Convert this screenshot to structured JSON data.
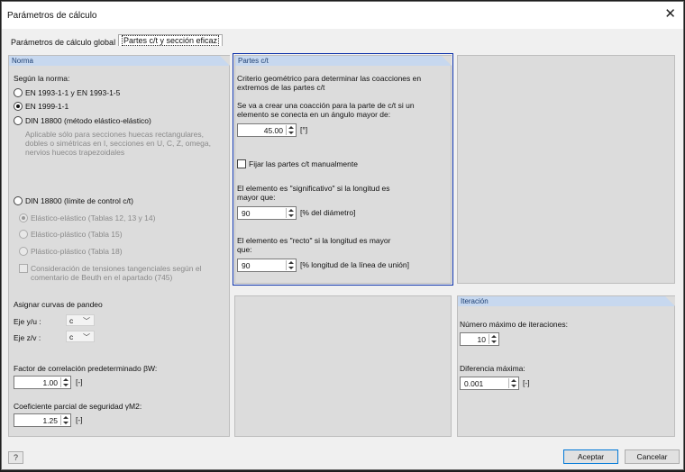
{
  "window": {
    "title": "Parámetros de cálculo",
    "close_icon": "close-icon"
  },
  "tabs": [
    {
      "label": "Parámetros de cálculo global"
    },
    {
      "label": "Partes c/t y sección eficaz",
      "active": true
    }
  ],
  "norma": {
    "header": "Norma",
    "segun_label": "Según la norma:",
    "opt1": "EN 1993-1-1 y EN 1993-1-5",
    "opt2": "EN 1999-1-1",
    "opt3": "DIN 18800 (método elástico-elástico)",
    "opt3_note": [
      "Aplicable sólo para secciones huecas rectangulares,",
      "dobles o simétricas en I, secciones en U, C, Z, omega,",
      "nervios huecos trapezoidales"
    ],
    "opt4": "DIN 18800 (límite de control c/t)",
    "sub1": "Elástico-elástico (Tablas 12, 13 y 14)",
    "sub2": "Elástico-plástico (Tabla 15)",
    "sub3": "Plástico-plástico (Tabla 18)",
    "sub4": [
      "Consideración de tensiones tangenciales según el",
      "comentario de Beuth en el apartado (745)"
    ],
    "selected": "EN 1999-1-1",
    "pandeo_label": "Asignar curvas de pandeo",
    "eje_y_label": "Eje y/u :",
    "eje_y_value": "c",
    "eje_z_label": "Eje z/v :",
    "eje_z_value": "c",
    "factor_label": "Factor de correlación predeterminado βW:",
    "factor_value": "1.00",
    "factor_unit": "[-]",
    "coef_label": "Coeficiente parcial de seguridad γM2:",
    "coef_value": "1.25",
    "coef_unit": "[-]"
  },
  "partes": {
    "header": "Partes c/t",
    "crit_text": [
      "Criterio geométrico para determinar las coacciones en",
      "extremos de las partes c/t"
    ],
    "angle_text": [
      "Se va a crear una coacción para la parte de c/t si un",
      "elemento se conecta en un ángulo mayor de:"
    ],
    "angle_value": "45.00",
    "angle_unit": "[°]",
    "manual_label": "Fijar las partes c/t manualmente",
    "manual_checked": false,
    "sig_text": [
      "El elemento es \"significativo\" si la longitud es",
      "mayor que:"
    ],
    "sig_value": "90",
    "sig_unit": "[% del diámetro]",
    "recto_text": [
      "El elemento es \"recto\" si la longitud es mayor",
      "que:"
    ],
    "recto_value": "90",
    "recto_unit": "[% longitud de la línea de unión]"
  },
  "iteracion": {
    "header": "Iteración",
    "max_label": "Número máximo de iteraciones:",
    "max_value": "10",
    "diff_label": "Diferencia máxima:",
    "diff_value": "0.001",
    "diff_unit": "[-]"
  },
  "footer": {
    "help_icon": "help-icon",
    "ok_label": "Aceptar",
    "cancel_label": "Cancelar"
  },
  "colors": {
    "accent_border": "#0a2fa8",
    "panel_header": "#c7d8ef",
    "panel_bg": "#dcdcdc"
  }
}
